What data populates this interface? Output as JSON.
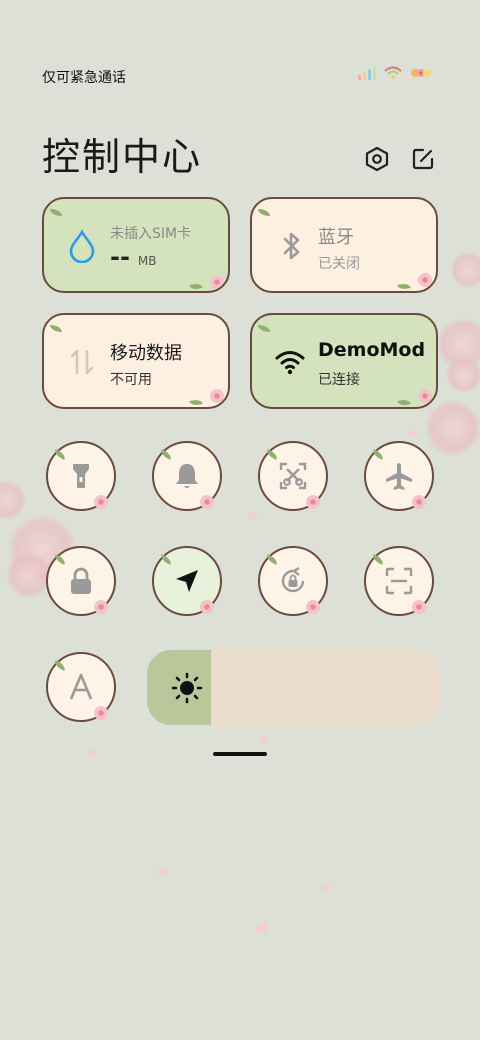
{
  "status_bar": {
    "carrier_text": "仅可紧急通话",
    "icons": [
      "signal-bars-icon",
      "wifi-icon",
      "battery-icon"
    ]
  },
  "header": {
    "title": "控制中心",
    "icons": [
      "settings-icon",
      "edit-icon"
    ]
  },
  "tiles": {
    "mobile_data_usage": {
      "label": "未插入SIM卡",
      "value": "--",
      "unit": "MB",
      "icon": "water-drop-icon",
      "active": true
    },
    "bluetooth": {
      "label": "蓝牙",
      "status": "已关闭",
      "icon": "bluetooth-icon",
      "active": false
    },
    "cellular": {
      "label": "移动数据",
      "status": "不可用",
      "icon": "data-arrows-icon",
      "active": false
    },
    "wifi": {
      "label": "DemoMod",
      "status": "已连接",
      "icon": "wifi-icon",
      "active": true
    }
  },
  "toggles": [
    {
      "name": "flashlight",
      "icon": "flashlight-icon",
      "active": false
    },
    {
      "name": "ringer",
      "icon": "bell-icon",
      "active": false
    },
    {
      "name": "screenshot",
      "icon": "screenshot-scissors-icon",
      "active": false
    },
    {
      "name": "airplane-mode",
      "icon": "airplane-icon",
      "active": false
    },
    {
      "name": "lock-screen",
      "icon": "lock-icon",
      "active": false
    },
    {
      "name": "location",
      "icon": "location-arrow-icon",
      "active": true
    },
    {
      "name": "rotation-lock",
      "icon": "rotation-lock-icon",
      "active": false
    },
    {
      "name": "scanner",
      "icon": "scan-icon",
      "active": false
    },
    {
      "name": "font-size",
      "icon": "font-a-icon",
      "active": false
    }
  ],
  "brightness": {
    "level": 0.22,
    "icon": "sun-icon"
  },
  "colors": {
    "background": "#dde0d6",
    "active_tile": "#d4e2bd",
    "inactive_tile": "#fdf0e1",
    "tile_border": "#6b4a3f",
    "accent_blue": "#2f9be5",
    "slider_fill": "#b9c79a",
    "slider_track": "#ecdccb"
  }
}
